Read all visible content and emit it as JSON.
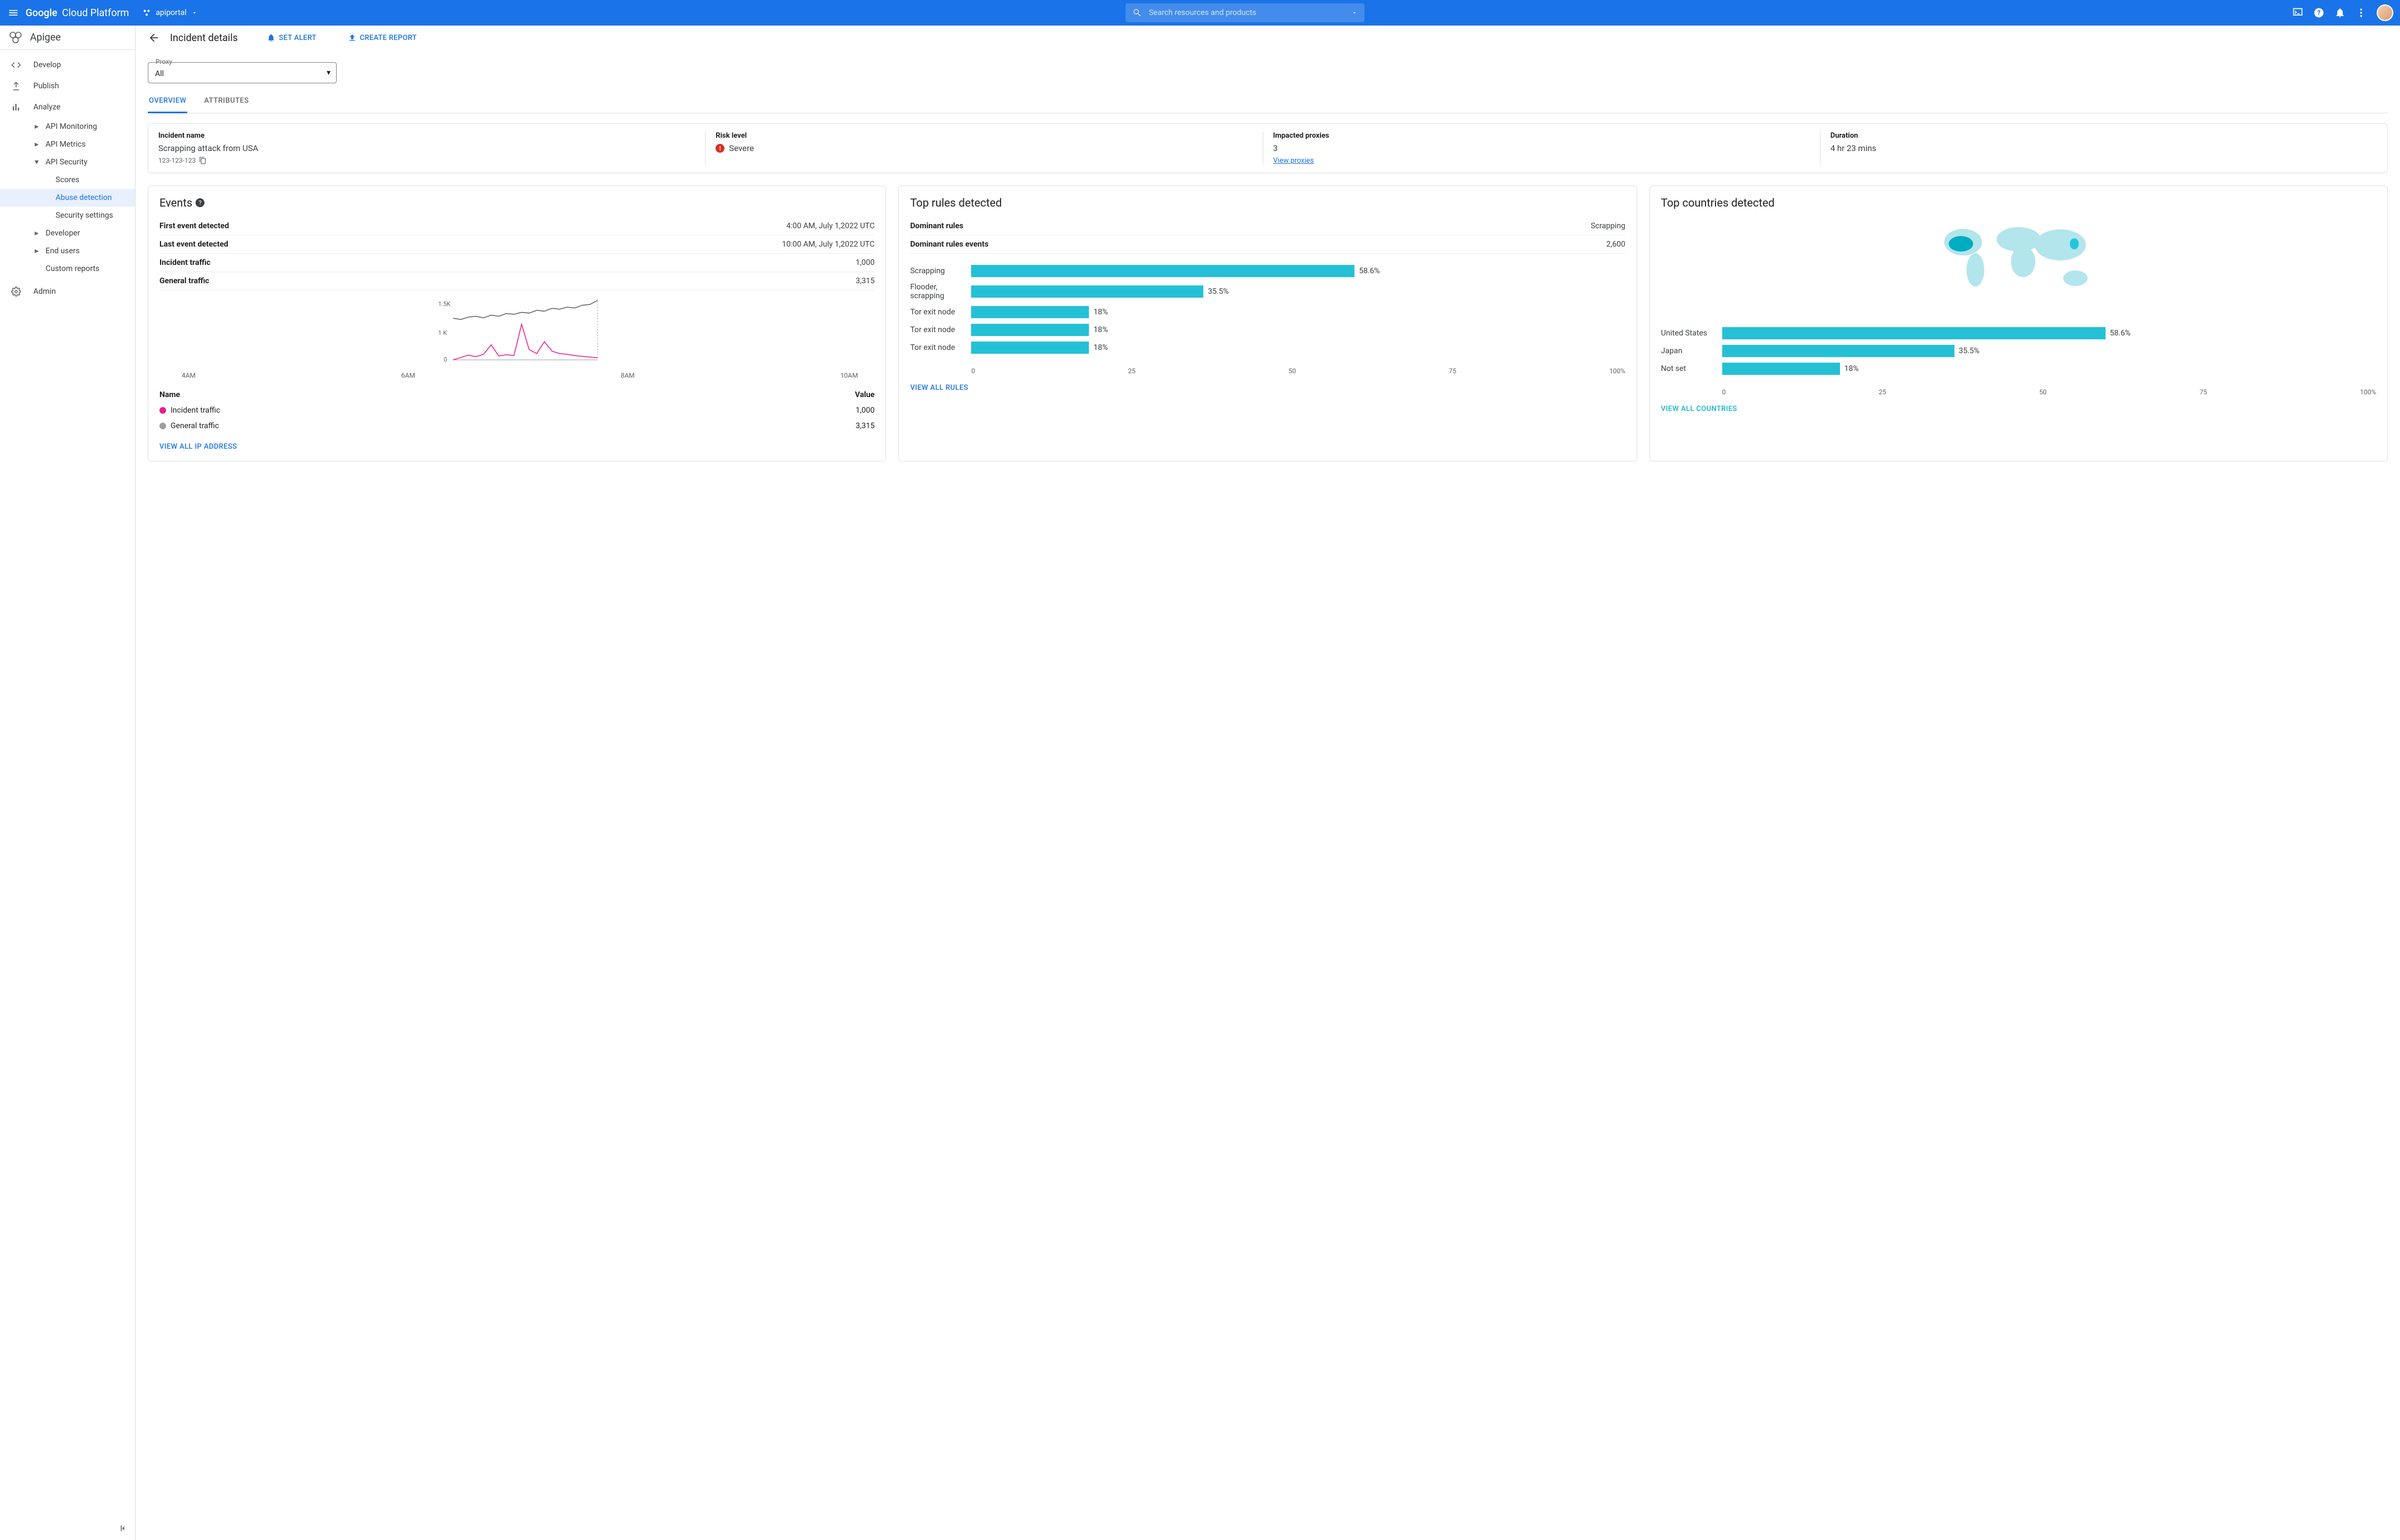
{
  "topbar": {
    "brand_prefix": "Google",
    "brand_suffix": "Cloud Platform",
    "project": "apiportal",
    "search_placeholder": "Search resources and products"
  },
  "sidebar": {
    "product": "Apigee",
    "items": [
      {
        "label": "Develop",
        "type": "top"
      },
      {
        "label": "Publish",
        "type": "top"
      },
      {
        "label": "Analyze",
        "type": "top"
      },
      {
        "label": "API Monitoring",
        "type": "sub",
        "caret": "right"
      },
      {
        "label": "API Metrics",
        "type": "sub",
        "caret": "right"
      },
      {
        "label": "API Security",
        "type": "sub",
        "caret": "down"
      },
      {
        "label": "Scores",
        "type": "leaf"
      },
      {
        "label": "Abuse detection",
        "type": "leaf",
        "active": true
      },
      {
        "label": "Security settings",
        "type": "leaf"
      },
      {
        "label": "Developer",
        "type": "sub",
        "caret": "right"
      },
      {
        "label": "End users",
        "type": "sub",
        "caret": "right"
      },
      {
        "label": "Custom reports",
        "type": "sub",
        "caret": "none"
      },
      {
        "label": "Admin",
        "type": "top"
      }
    ]
  },
  "page": {
    "title": "Incident details",
    "actions": {
      "set_alert": "SET ALERT",
      "create_report": "CREATE REPORT"
    },
    "proxy": {
      "legend": "Proxy",
      "value": "All"
    },
    "tabs": {
      "overview": "OVERVIEW",
      "attributes": "ATTRIBUTES"
    }
  },
  "summary": {
    "incident_name": {
      "label": "Incident name",
      "value": "Scrapping attack from USA",
      "id": "123-123-123"
    },
    "risk_level": {
      "label": "Risk level",
      "value": "Severe"
    },
    "impacted_proxies": {
      "label": "Impacted proxies",
      "value": "3",
      "link": "View proxies"
    },
    "duration": {
      "label": "Duration",
      "value": "4 hr 23 mins"
    }
  },
  "events_card": {
    "title": "Events",
    "rows": [
      {
        "k": "First event detected",
        "v": "4:00 AM, July 1,2022 UTC"
      },
      {
        "k": "Last event detected",
        "v": "10:00 AM, July 1,2022 UTC"
      },
      {
        "k": "Incident traffic",
        "v": "1,000"
      },
      {
        "k": "General traffic",
        "v": "3,315"
      }
    ],
    "legend_header": {
      "name": "Name",
      "value": "Value"
    },
    "legend": [
      {
        "name": "Incident traffic",
        "value": "1,000",
        "color": "#e91e8c"
      },
      {
        "name": "General traffic",
        "value": "3,315",
        "color": "#9e9e9e"
      }
    ],
    "view_all": "VIEW ALL IP ADDRESS"
  },
  "rules_card": {
    "title": "Top  rules detected",
    "rows": [
      {
        "k": "Dominant rules",
        "v": "Scrapping"
      },
      {
        "k": "Dominant rules events",
        "v": "2,600"
      }
    ],
    "view_all": "VIEW ALL RULES"
  },
  "countries_card": {
    "title": "Top countries detected",
    "view_all": "VIEW ALL COUNTRIES"
  },
  "chart_data": {
    "events_line": {
      "type": "line",
      "x_ticks": [
        "4AM",
        "6AM",
        "8AM",
        "10AM"
      ],
      "y_ticks": [
        "0",
        "1 K",
        "1.5K"
      ],
      "ylim": [
        0,
        1500
      ],
      "series": [
        {
          "name": "General traffic",
          "color": "#616161",
          "values": [
            1050,
            1020,
            1080,
            1100,
            1060,
            1130,
            1100,
            1170,
            1150,
            1200,
            1180,
            1250,
            1230,
            1300,
            1280,
            1330,
            1310,
            1380,
            1400,
            1500
          ]
        },
        {
          "name": "Incident traffic",
          "color": "#e91e8c",
          "values": [
            0,
            60,
            120,
            80,
            140,
            380,
            100,
            130,
            110,
            900,
            260,
            160,
            460,
            220,
            160,
            140,
            110,
            90,
            70,
            50
          ]
        }
      ]
    },
    "rules_bar": {
      "type": "bar",
      "orientation": "horizontal",
      "xlim": [
        0,
        100
      ],
      "x_ticks": [
        "0",
        "25",
        "50",
        "75",
        "100%"
      ],
      "bars": [
        {
          "label": "Scrapping",
          "value": 58.6,
          "display": "58.6%"
        },
        {
          "label": "Flooder, scrapping",
          "value": 35.5,
          "display": "35.5%"
        },
        {
          "label": "Tor exit node",
          "value": 18,
          "display": "18%"
        },
        {
          "label": "Tor exit node",
          "value": 18,
          "display": "18%"
        },
        {
          "label": "Tor exit node",
          "value": 18,
          "display": "18%"
        }
      ]
    },
    "countries_bar": {
      "type": "bar",
      "orientation": "horizontal",
      "xlim": [
        0,
        100
      ],
      "x_ticks": [
        "0",
        "25",
        "50",
        "75",
        "100%"
      ],
      "bars": [
        {
          "label": "United States",
          "value": 58.6,
          "display": "58.6%"
        },
        {
          "label": "Japan",
          "value": 35.5,
          "display": "35.5%"
        },
        {
          "label": "Not set",
          "value": 18,
          "display": "18%"
        }
      ]
    },
    "countries_map": {
      "type": "choropleth",
      "highlighted": [
        "United States",
        "Japan"
      ]
    }
  }
}
